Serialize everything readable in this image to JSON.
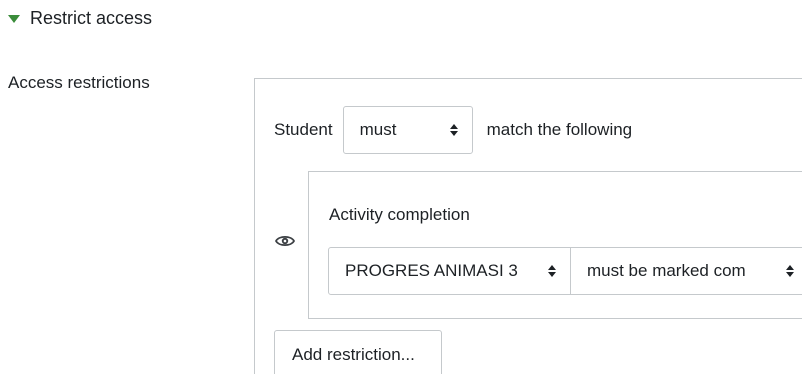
{
  "section": {
    "title": "Restrict access",
    "expanded": true,
    "toggle_color": "#3a8c3a"
  },
  "field": {
    "label": "Access restrictions"
  },
  "restriction_set": {
    "prefix_label": "Student",
    "match_select_value": "must",
    "suffix_label": "match the following"
  },
  "condition": {
    "title": "Activity completion",
    "visibility_icon": "eye-icon",
    "activity_select_value": "PROGRES ANIMASI 3",
    "requirement_select_value": "must be marked com"
  },
  "actions": {
    "add_restriction_label": "Add restriction..."
  }
}
